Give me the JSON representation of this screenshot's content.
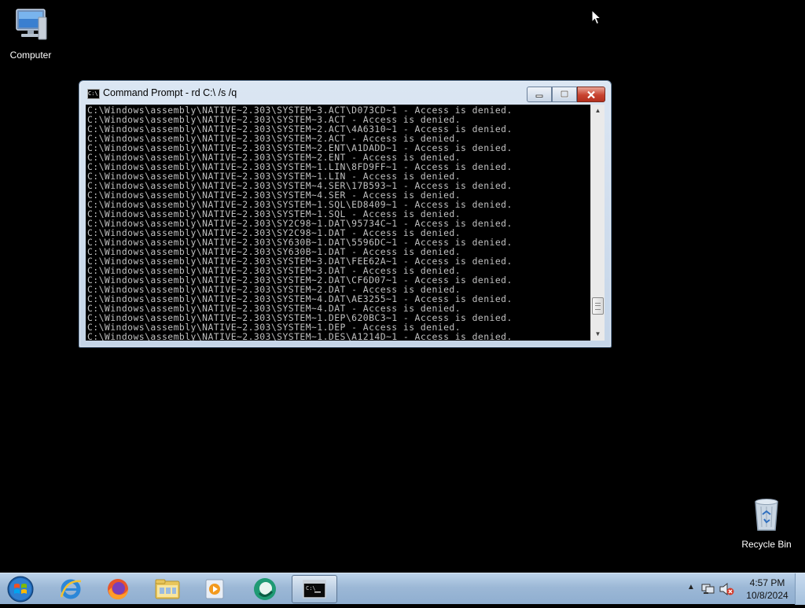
{
  "desktop": {
    "icons": [
      {
        "label": "Computer"
      },
      {
        "label": "Recycle Bin"
      }
    ]
  },
  "cmd_window": {
    "title": "Command Prompt - rd  C:\\ /s /q",
    "title_icon_text": "C:\\",
    "lines": [
      "C:\\Windows\\assembly\\NATIVE~2.303\\SYSTEM~3.ACT\\D073CD~1 - Access is denied.",
      "C:\\Windows\\assembly\\NATIVE~2.303\\SYSTEM~3.ACT - Access is denied.",
      "C:\\Windows\\assembly\\NATIVE~2.303\\SYSTEM~2.ACT\\4A6310~1 - Access is denied.",
      "C:\\Windows\\assembly\\NATIVE~2.303\\SYSTEM~2.ACT - Access is denied.",
      "C:\\Windows\\assembly\\NATIVE~2.303\\SYSTEM~2.ENT\\A1DADD~1 - Access is denied.",
      "C:\\Windows\\assembly\\NATIVE~2.303\\SYSTEM~2.ENT - Access is denied.",
      "C:\\Windows\\assembly\\NATIVE~2.303\\SYSTEM~1.LIN\\8FD9FF~1 - Access is denied.",
      "C:\\Windows\\assembly\\NATIVE~2.303\\SYSTEM~1.LIN - Access is denied.",
      "C:\\Windows\\assembly\\NATIVE~2.303\\SYSTEM~4.SER\\17B593~1 - Access is denied.",
      "C:\\Windows\\assembly\\NATIVE~2.303\\SYSTEM~4.SER - Access is denied.",
      "C:\\Windows\\assembly\\NATIVE~2.303\\SYSTEM~1.SQL\\ED8409~1 - Access is denied.",
      "C:\\Windows\\assembly\\NATIVE~2.303\\SYSTEM~1.SQL - Access is denied.",
      "C:\\Windows\\assembly\\NATIVE~2.303\\SY2C98~1.DAT\\95734C~1 - Access is denied.",
      "C:\\Windows\\assembly\\NATIVE~2.303\\SY2C98~1.DAT - Access is denied.",
      "C:\\Windows\\assembly\\NATIVE~2.303\\SY630B~1.DAT\\5596DC~1 - Access is denied.",
      "C:\\Windows\\assembly\\NATIVE~2.303\\SY630B~1.DAT - Access is denied.",
      "C:\\Windows\\assembly\\NATIVE~2.303\\SYSTEM~3.DAT\\FEE62A~1 - Access is denied.",
      "C:\\Windows\\assembly\\NATIVE~2.303\\SYSTEM~3.DAT - Access is denied.",
      "C:\\Windows\\assembly\\NATIVE~2.303\\SYSTEM~2.DAT\\CF6D07~1 - Access is denied.",
      "C:\\Windows\\assembly\\NATIVE~2.303\\SYSTEM~2.DAT - Access is denied.",
      "C:\\Windows\\assembly\\NATIVE~2.303\\SYSTEM~4.DAT\\AE3255~1 - Access is denied.",
      "C:\\Windows\\assembly\\NATIVE~2.303\\SYSTEM~4.DAT - Access is denied.",
      "C:\\Windows\\assembly\\NATIVE~2.303\\SYSTEM~1.DEP\\620BC3~1 - Access is denied.",
      "C:\\Windows\\assembly\\NATIVE~2.303\\SYSTEM~1.DEP - Access is denied.",
      "C:\\Windows\\assembly\\NATIVE~2.303\\SYSTEM~1.DES\\A1214D~1 - Access is denied."
    ],
    "scroll_position": 0.93,
    "colors": {
      "console_bg": "#000000",
      "console_text": "#c0c0c0",
      "close_button": "#c84330"
    }
  },
  "taskbar": {
    "apps": [
      {
        "name": "internet-explorer"
      },
      {
        "name": "firefox"
      },
      {
        "name": "windows-explorer"
      },
      {
        "name": "media-player"
      },
      {
        "name": "green-app"
      },
      {
        "name": "command-prompt",
        "active": true
      }
    ],
    "tray_icons": [
      "show-hidden-icons",
      "network-icon",
      "volume-muted-icon"
    ],
    "clock": {
      "time": "4:57 PM",
      "date": "10/8/2024"
    }
  }
}
